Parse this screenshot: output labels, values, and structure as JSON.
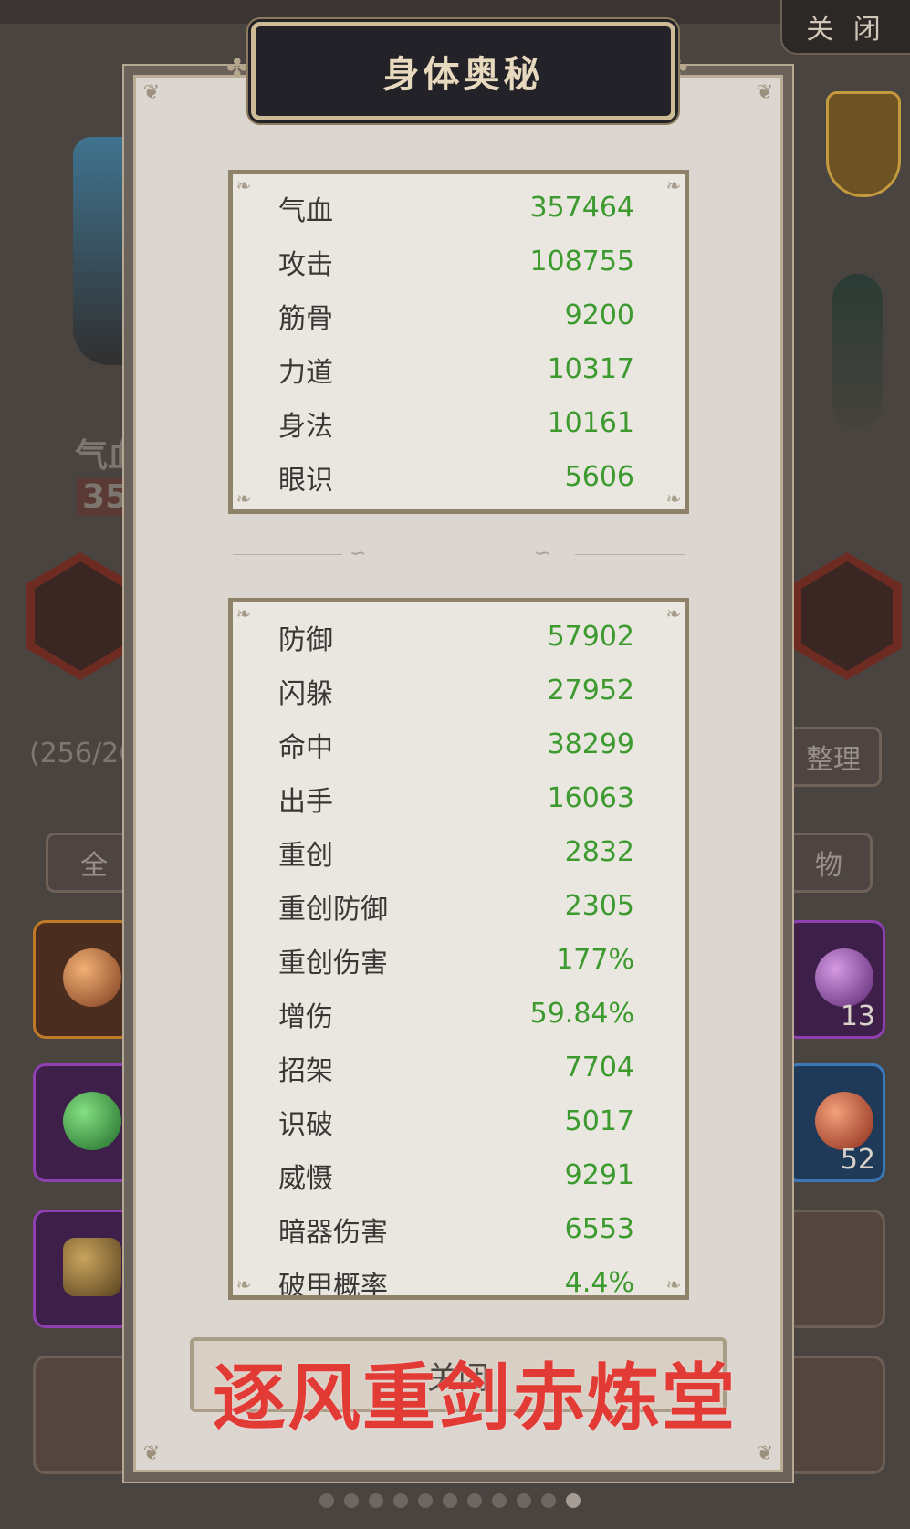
{
  "background": {
    "close_tab_label": "关 闭",
    "left_partial_labels": [
      "气血",
      "35",
      "(256/26"
    ],
    "right_partial_labels": [
      "整理",
      "物",
      "全"
    ],
    "slot_counts": [
      "13",
      "52"
    ]
  },
  "modal": {
    "title": "身体奥秘",
    "primary_stats": [
      {
        "label": "气血",
        "value": "357464"
      },
      {
        "label": "攻击",
        "value": "108755"
      },
      {
        "label": "筋骨",
        "value": "9200"
      },
      {
        "label": "力道",
        "value": "10317"
      },
      {
        "label": "身法",
        "value": "10161"
      },
      {
        "label": "眼识",
        "value": "5606"
      }
    ],
    "secondary_stats": [
      {
        "label": "防御",
        "value": "57902"
      },
      {
        "label": "闪躲",
        "value": "27952"
      },
      {
        "label": "命中",
        "value": "38299"
      },
      {
        "label": "出手",
        "value": "16063"
      },
      {
        "label": "重创",
        "value": "2832"
      },
      {
        "label": "重创防御",
        "value": "2305"
      },
      {
        "label": "重创伤害",
        "value": "177%"
      },
      {
        "label": "增伤",
        "value": "59.84%"
      },
      {
        "label": "招架",
        "value": "7704"
      },
      {
        "label": "识破",
        "value": "5017"
      },
      {
        "label": "威慑",
        "value": "9291"
      },
      {
        "label": "暗器伤害",
        "value": "6553"
      },
      {
        "label": "破甲概率",
        "value": "4.4%"
      }
    ],
    "close_label": "关闭"
  },
  "watermark": "逐风重剑赤炼堂",
  "colors": {
    "stat_value": "#3d9a2f",
    "title_plate": "#232228",
    "watermark": "#e23a35"
  },
  "pager": {
    "total": 11,
    "active": 11
  }
}
